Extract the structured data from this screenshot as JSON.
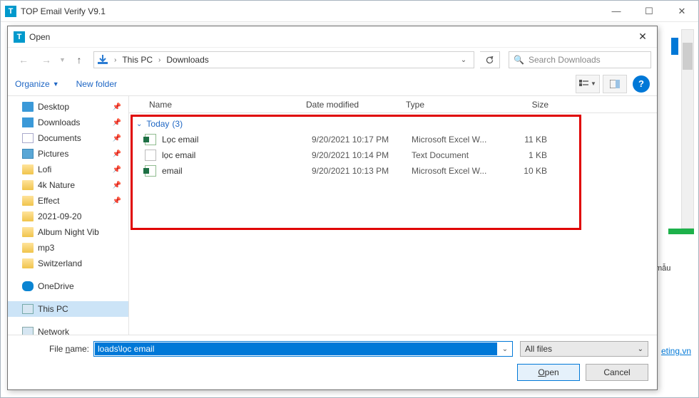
{
  "parent": {
    "title": "TOP Email Verify V9.1",
    "bg_btn": "mẫu",
    "bg_link": "eting.vn"
  },
  "dialog": {
    "title": "Open",
    "breadcrumb": [
      "This PC",
      "Downloads"
    ],
    "search_placeholder": "Search Downloads",
    "organize": "Organize",
    "new_folder": "New folder",
    "columns": {
      "name": "Name",
      "date": "Date modified",
      "type": "Type",
      "size": "Size"
    },
    "group": {
      "label": "Today",
      "count": "(3)"
    },
    "files": [
      {
        "icon": "xls",
        "name": "Lọc email",
        "date": "9/20/2021 10:17 PM",
        "type": "Microsoft Excel W...",
        "size": "11 KB"
      },
      {
        "icon": "txt",
        "name": "lọc email",
        "date": "9/20/2021 10:14 PM",
        "type": "Text Document",
        "size": "1 KB"
      },
      {
        "icon": "xls",
        "name": "email",
        "date": "9/20/2021 10:13 PM",
        "type": "Microsoft Excel W...",
        "size": "10 KB"
      }
    ],
    "nav_items": [
      {
        "icon": "desktop",
        "label": "Desktop",
        "pinned": true
      },
      {
        "icon": "downloads",
        "label": "Downloads",
        "pinned": true
      },
      {
        "icon": "docs",
        "label": "Documents",
        "pinned": true
      },
      {
        "icon": "pics",
        "label": "Pictures",
        "pinned": true
      },
      {
        "icon": "folder",
        "label": "Lofi",
        "pinned": true
      },
      {
        "icon": "folder",
        "label": "4k Nature",
        "pinned": true
      },
      {
        "icon": "folder",
        "label": "Effect",
        "pinned": true
      },
      {
        "icon": "folder",
        "label": "2021-09-20",
        "pinned": false
      },
      {
        "icon": "folder",
        "label": "Album Night Vib",
        "pinned": false
      },
      {
        "icon": "folder",
        "label": "mp3",
        "pinned": false
      },
      {
        "icon": "folder",
        "label": "Switzerland",
        "pinned": false
      },
      {
        "icon": "spacer"
      },
      {
        "icon": "onedrive",
        "label": "OneDrive"
      },
      {
        "icon": "spacer"
      },
      {
        "icon": "pc",
        "label": "This PC",
        "selected": true
      },
      {
        "icon": "spacer"
      },
      {
        "icon": "net",
        "label": "Network"
      }
    ],
    "file_name_label": "File name:",
    "file_name_value": "loads\\lọc email",
    "filter": "All files",
    "open_btn": "Open",
    "cancel_btn": "Cancel"
  }
}
